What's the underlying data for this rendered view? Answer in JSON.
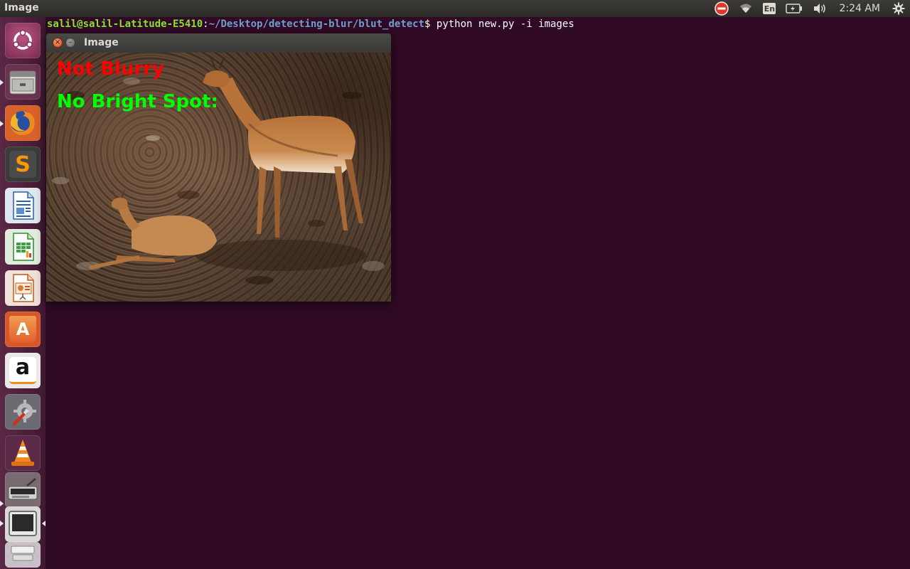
{
  "top_panel": {
    "app_title": "Image",
    "keyboard_layout": "En",
    "clock": "2:24 AM",
    "icons": [
      "no-entry-icon",
      "wifi-icon",
      "keyboard-layout-icon",
      "battery-icon",
      "volume-icon",
      "gear-icon"
    ]
  },
  "launcher": {
    "items": [
      {
        "name": "launcher-dash",
        "icon": "ubuntu-logo-icon"
      },
      {
        "name": "launcher-files",
        "icon": "file-cabinet-icon"
      },
      {
        "name": "launcher-firefox",
        "icon": "firefox-icon"
      },
      {
        "name": "launcher-sublime-text",
        "icon": "sublime-text-icon"
      },
      {
        "name": "launcher-libreoffice-writer",
        "icon": "writer-icon"
      },
      {
        "name": "launcher-libreoffice-calc",
        "icon": "calc-icon"
      },
      {
        "name": "launcher-libreoffice-impress",
        "icon": "impress-icon"
      },
      {
        "name": "launcher-software-center",
        "icon": "shopping-bag-icon"
      },
      {
        "name": "launcher-amazon",
        "icon": "amazon-icon"
      },
      {
        "name": "launcher-system-settings",
        "icon": "wrench-gear-icon"
      },
      {
        "name": "launcher-vlc",
        "icon": "vlc-cone-icon"
      },
      {
        "name": "launcher-scanner",
        "icon": "scanner-icon"
      },
      {
        "name": "launcher-terminal",
        "icon": "monitor-icon"
      },
      {
        "name": "launcher-stacked-app",
        "icon": "stack-icon"
      }
    ],
    "amazon_glyph": "a",
    "sublime_glyph": "S",
    "software_glyph": "A"
  },
  "terminal": {
    "user_host": "salil@salil-Latitude-E5410",
    "separator": ":",
    "path": "~/Desktop/detecting-blur/blut_detect",
    "prompt": "$ ",
    "command": "python new.py -i images"
  },
  "image_window": {
    "title": "Image",
    "close_symbol": "×",
    "minimize_symbol": "–",
    "overlay_lines": [
      {
        "text": "Not Blurry",
        "color": "#ff0000"
      },
      {
        "text": "No Bright Spot:",
        "color": "#00ff00"
      }
    ]
  },
  "colors": {
    "desktop_bg": "#300a24",
    "terminal_user": "#8ae234",
    "terminal_path": "#729fcf",
    "panel_bg": "#3c3b37"
  }
}
